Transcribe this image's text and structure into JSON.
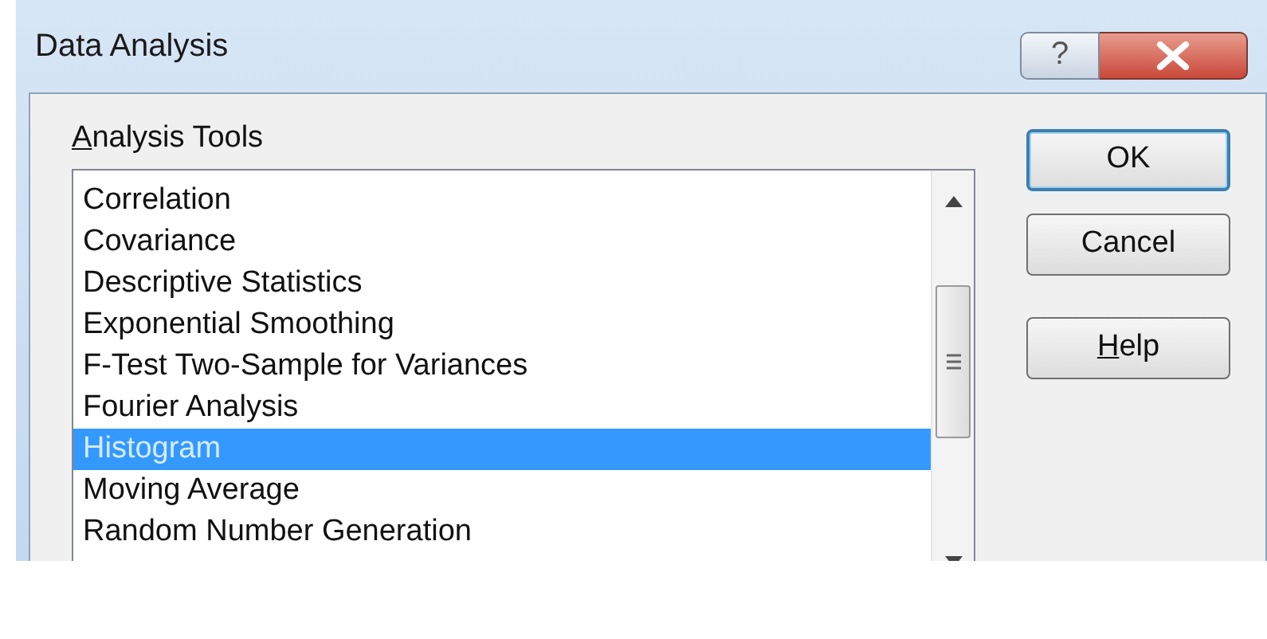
{
  "window": {
    "title": "Data Analysis",
    "help_glyph": "?"
  },
  "analysis_tools": {
    "label": "Analysis Tools",
    "mnemonic": true,
    "items": [
      {
        "label": "Correlation",
        "selected": false
      },
      {
        "label": "Covariance",
        "selected": false
      },
      {
        "label": "Descriptive Statistics",
        "selected": false
      },
      {
        "label": "Exponential Smoothing",
        "selected": false
      },
      {
        "label": "F-Test Two-Sample for Variances",
        "selected": false
      },
      {
        "label": "Fourier Analysis",
        "selected": false
      },
      {
        "label": "Histogram",
        "selected": true
      },
      {
        "label": "Moving Average",
        "selected": false
      },
      {
        "label": "Random Number Generation",
        "selected": false
      }
    ]
  },
  "buttons": [
    {
      "label": "OK",
      "default": true,
      "mnemonic": false
    },
    {
      "label": "Cancel",
      "default": false,
      "mnemonic": false
    },
    {
      "label": "Help",
      "default": false,
      "mnemonic": true
    }
  ]
}
